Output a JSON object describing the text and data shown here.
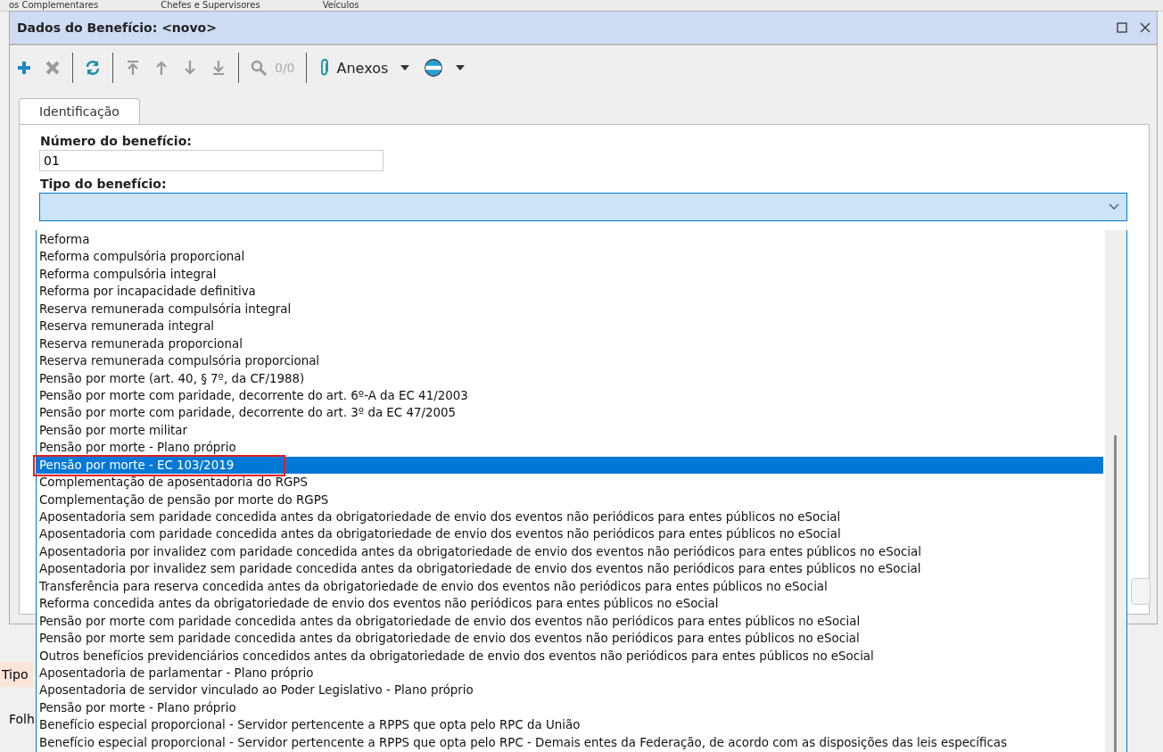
{
  "background": {
    "top_tabs": [
      "os Complementares",
      "Chefes e Supervisores",
      "Veículos"
    ],
    "left_labels": [
      "Tipo",
      "Folh"
    ]
  },
  "window": {
    "title": "Dados do Benefício: <novo>"
  },
  "toolbar": {
    "counter": "0/0",
    "attachments_label": "Anexos"
  },
  "tabs": [
    {
      "label": "Identificação",
      "selected": true
    }
  ],
  "form": {
    "number_label": "Número do benefício:",
    "number_value": "01",
    "type_label": "Tipo do benefício:"
  },
  "dropdown": {
    "expanded": true,
    "items": [
      {
        "label": "Reforma",
        "selected": false
      },
      {
        "label": "Reforma compulsória proporcional",
        "selected": false
      },
      {
        "label": "Reforma compulsória integral",
        "selected": false
      },
      {
        "label": "Reforma por incapacidade definitiva",
        "selected": false
      },
      {
        "label": "Reserva remunerada compulsória integral",
        "selected": false
      },
      {
        "label": "Reserva remunerada integral",
        "selected": false
      },
      {
        "label": "Reserva remunerada proporcional",
        "selected": false
      },
      {
        "label": "Reserva remunerada compulsória proporcional",
        "selected": false
      },
      {
        "label": "Pensão por morte (art. 40, § 7º, da CF/1988)",
        "selected": false
      },
      {
        "label": "Pensão por morte com paridade, decorrente do art. 6º-A da EC 41/2003",
        "selected": false
      },
      {
        "label": "Pensão por morte com paridade, decorrente do art. 3º da EC 47/2005",
        "selected": false
      },
      {
        "label": "Pensão por morte militar",
        "selected": false
      },
      {
        "label": "Pensão por morte - Plano próprio",
        "selected": false
      },
      {
        "label": "Pensão por morte - EC 103/2019",
        "selected": true
      },
      {
        "label": "Complementação de aposentadoria do RGPS",
        "selected": false
      },
      {
        "label": "Complementação de pensão por morte do RGPS",
        "selected": false
      },
      {
        "label": "Aposentadoria sem paridade concedida antes da obrigatoriedade de envio dos eventos não periódicos para entes públicos no eSocial",
        "selected": false
      },
      {
        "label": "Aposentadoria com paridade concedida antes da obrigatoriedade de envio dos eventos não periódicos para entes públicos no eSocial",
        "selected": false
      },
      {
        "label": "Aposentadoria por invalidez com paridade concedida antes da obrigatoriedade de envio dos eventos não periódicos para entes públicos no eSocial",
        "selected": false
      },
      {
        "label": "Aposentadoria por invalidez sem paridade concedida antes da obrigatoriedade de envio dos eventos não periódicos para entes públicos no eSocial",
        "selected": false
      },
      {
        "label": "Transferência para reserva concedida antes da obrigatoriedade de envio dos eventos não periódicos para entes públicos no eSocial",
        "selected": false
      },
      {
        "label": "Reforma concedida antes da obrigatoriedade de envio dos eventos não periódicos para entes públicos no eSocial",
        "selected": false
      },
      {
        "label": "Pensão por morte com paridade concedida antes da obrigatoriedade de envio dos eventos não periódicos para entes públicos no eSocial",
        "selected": false
      },
      {
        "label": "Pensão por morte sem paridade concedida antes da obrigatoriedade de envio dos eventos não periódicos para entes públicos no eSocial",
        "selected": false
      },
      {
        "label": "Outros benefícios previdenciários concedidos antes da obrigatoriedade de envio dos eventos não periódicos para entes públicos no eSocial",
        "selected": false
      },
      {
        "label": "Aposentadoria de parlamentar - Plano próprio",
        "selected": false
      },
      {
        "label": "Aposentadoria de servidor vinculado ao Poder Legislativo - Plano próprio",
        "selected": false
      },
      {
        "label": "Pensão por morte - Plano próprio",
        "selected": false
      },
      {
        "label": "Benefício especial proporcional - Servidor pertencente a RPPS que opta pelo RPC da União",
        "selected": false
      },
      {
        "label": "Benefício especial proporcional - Servidor pertencente a RPPS que opta pelo RPC - Demais entes da Federação, de acordo com as disposições das leis específicas",
        "selected": false
      }
    ]
  }
}
